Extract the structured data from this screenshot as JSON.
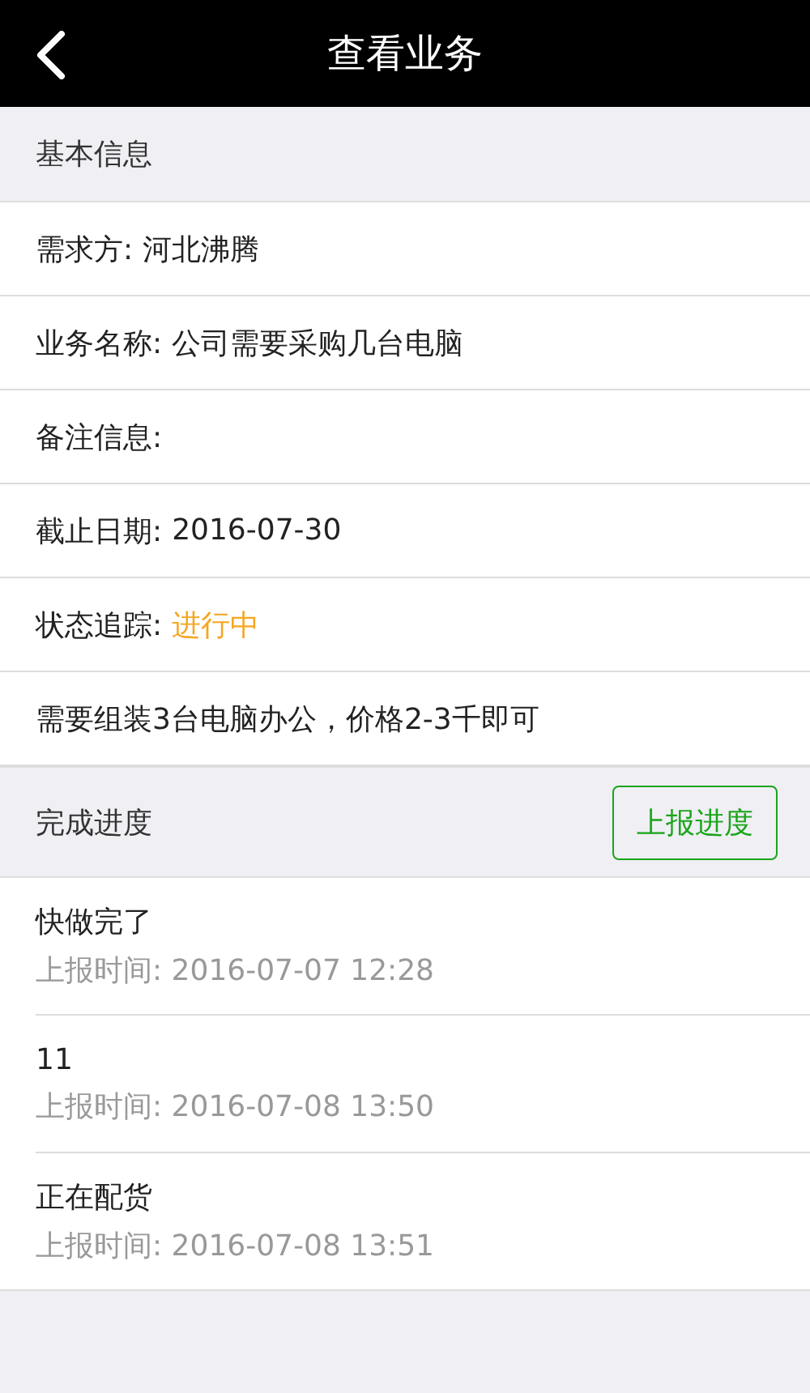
{
  "nav_bar": {
    "title": "查看业务"
  },
  "basic_info": {
    "title": "基本信息",
    "rows": [
      {
        "kind": "field",
        "label": "需求方:",
        "value": "河北沸腾"
      },
      {
        "kind": "field",
        "label": "业务名称:",
        "value": "公司需要采购几台电脑"
      },
      {
        "kind": "field",
        "label": "备注信息:"
      },
      {
        "kind": "field",
        "label": "截止日期:",
        "value": "2016-07-30"
      },
      {
        "kind": "status",
        "label": "状态追踪:",
        "value": "进行中"
      },
      {
        "kind": "note",
        "text": "需要组装3台电脑办公，价格2-3千即可"
      }
    ]
  },
  "progress": {
    "title": "完成进度",
    "button": "上报进度",
    "entries": [
      {
        "text": "快做完了",
        "time": "上报时间: 2016-07-07 12:28"
      },
      {
        "text": "11",
        "time": "上报时间: 2016-07-08 13:50"
      },
      {
        "text": "正在配货",
        "time": "上报时间: 2016-07-08 13:51"
      }
    ]
  }
}
